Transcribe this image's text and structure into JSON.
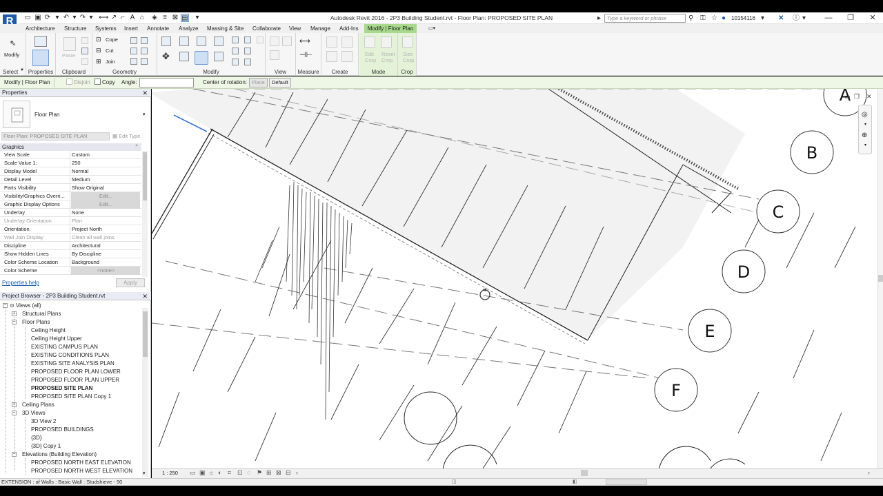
{
  "app": {
    "window_title": "Autodesk Revit 2016 -   2P3 Building Student.rvt - Floor Plan: PROPOSED SITE PLAN",
    "search_placeholder": "Type a keyword or phrase",
    "user": "10154116",
    "logo_letter": "R"
  },
  "ribbon_tabs": [
    "Architecture",
    "Structure",
    "Systems",
    "Insert",
    "Annotate",
    "Analyze",
    "Massing & Site",
    "Collaborate",
    "View",
    "Manage",
    "Add-Ins"
  ],
  "active_tab": "Modify | Floor Plan",
  "ribbon": {
    "select": {
      "modify_label": "Modify",
      "panel": "Select"
    },
    "properties_panel": "Properties",
    "clipboard": {
      "paste": "Paste",
      "panel": "Clipboard"
    },
    "geometry": {
      "cope": "Cope",
      "cut": "Cut",
      "join": "Join",
      "panel": "Geometry"
    },
    "modify_panel": "Modify",
    "view_panel": "View",
    "measure_panel": "Measure",
    "create_panel": "Create",
    "mode": {
      "edit_crop": "Edit Crop",
      "reset_crop": "Reset Crop",
      "panel": "Mode"
    },
    "crop": {
      "size_crop": "Size Crop",
      "panel": "Crop"
    }
  },
  "options_bar": {
    "context": "Modify | Floor Plan",
    "disjoin": "Disjoin",
    "copy": "Copy",
    "angle_label": "Angle:",
    "center_label": "Center of rotation:",
    "place": "Place",
    "default": "Default"
  },
  "properties": {
    "header": "Properties",
    "type_name": "Floor Plan",
    "instance_filter": "Floor Plan: PROPOSED SITE PLAN",
    "edit_type": "Edit Type",
    "group": "Graphics",
    "rows": [
      {
        "name": "View Scale",
        "value": "Custom"
      },
      {
        "name": "Scale Value    1:",
        "value": "250"
      },
      {
        "name": "Display Model",
        "value": "Normal"
      },
      {
        "name": "Detail Level",
        "value": "Medium"
      },
      {
        "name": "Parts Visibility",
        "value": "Show Original"
      },
      {
        "name": "Visibility/Graphics Overri...",
        "value": "Edit..."
      },
      {
        "name": "Graphic Display Options",
        "value": "Edit..."
      },
      {
        "name": "Underlay",
        "value": "None"
      },
      {
        "name": "Underlay Orientation",
        "value": "Plan"
      },
      {
        "name": "Orientation",
        "value": "Project North"
      },
      {
        "name": "Wall Join Display",
        "value": "Clean all wall joins"
      },
      {
        "name": "Discipline",
        "value": "Architectural"
      },
      {
        "name": "Show Hidden Lines",
        "value": "By Discipline"
      },
      {
        "name": "Color Scheme Location",
        "value": "Background"
      },
      {
        "name": "Color Scheme",
        "value": "<none>"
      }
    ],
    "help": "Properties help",
    "apply": "Apply"
  },
  "project_browser": {
    "header": "Project Browser - 2P3 Building Student.rvt",
    "nodes": [
      {
        "label": "Views (all)"
      },
      {
        "label": "Structural Plans"
      },
      {
        "label": "Floor Plans"
      },
      {
        "label": "Ceiling Height"
      },
      {
        "label": "Ceiling Height Upper"
      },
      {
        "label": "EXISTING CAMPUS PLAN"
      },
      {
        "label": "EXISTING CONDITIONS PLAN"
      },
      {
        "label": "EXISTING SITE ANALYSIS PLAN"
      },
      {
        "label": "PROPOSED FLOOR PLAN LOWER"
      },
      {
        "label": "PROPOSED FLOOR PLAN UPPER"
      },
      {
        "label": "PROPOSED SITE PLAN"
      },
      {
        "label": "PROPOSED SITE PLAN Copy 1"
      },
      {
        "label": "Ceiling Plans"
      },
      {
        "label": "3D Views"
      },
      {
        "label": "3D View 2"
      },
      {
        "label": "PROPOSED BUILDINGS"
      },
      {
        "label": "{3D}"
      },
      {
        "label": "{3D} Copy 1"
      },
      {
        "label": "Elevations (Building Elevation)"
      },
      {
        "label": "PROPOSED NORTH EAST ELEVATION"
      },
      {
        "label": "PROPOSED NORTH WEST ELEVATION"
      }
    ]
  },
  "grid_bubbles": [
    "A",
    "B",
    "C",
    "D",
    "E",
    "F"
  ],
  "view_controls": {
    "scale": "1 : 250"
  },
  "status": {
    "text": "EXTENSION : af Walls : Basic Wall : Studshieve - 90"
  },
  "colors": {
    "accent_green": "#a8d98c",
    "brand_blue": "#1d5ba8",
    "selection_blue": "#3a6fd0"
  }
}
